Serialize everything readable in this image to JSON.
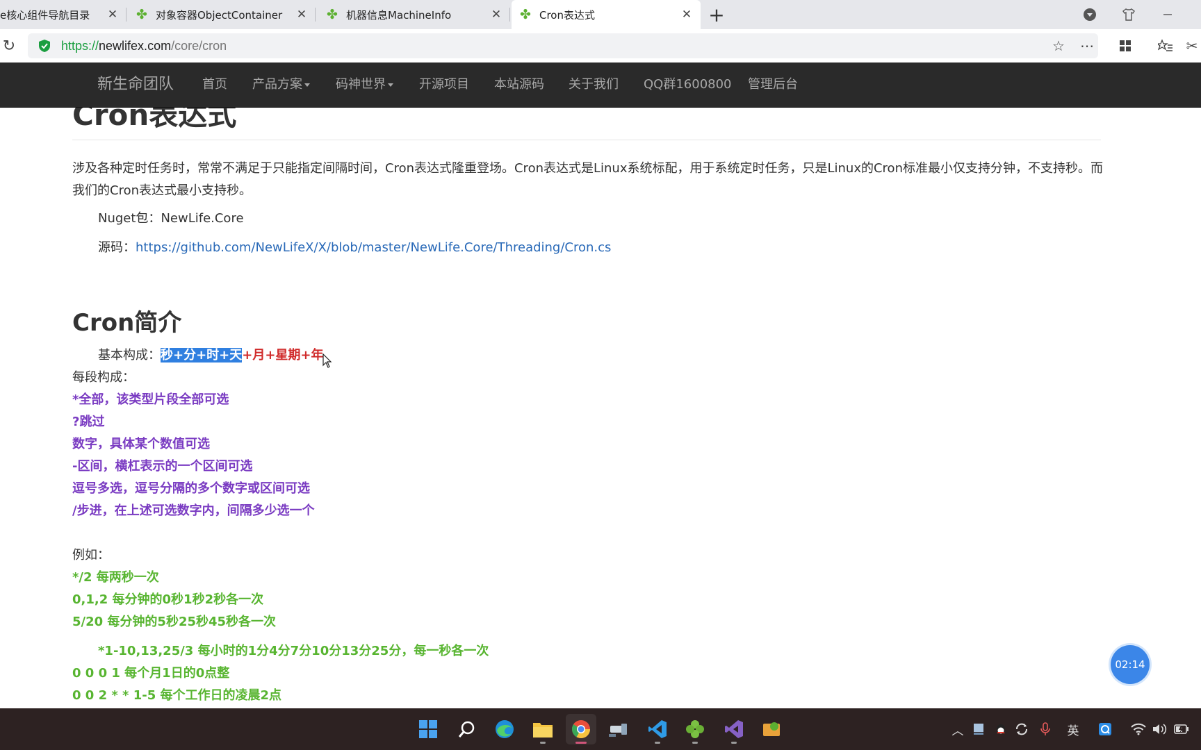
{
  "browser": {
    "tabs": [
      {
        "label": "e核心组件导航目录",
        "icon": "clover-icon"
      },
      {
        "label": "对象容器ObjectContainer",
        "icon": "clover-icon"
      },
      {
        "label": "机器信息MachineInfo",
        "icon": "clover-icon"
      },
      {
        "label": "Cron表达式",
        "icon": "clover-icon",
        "active": true
      }
    ],
    "new_tab": "+",
    "close_glyph": "✕",
    "url": {
      "scheme": "https://",
      "host": "newlifex.com",
      "path": "/core/cron"
    }
  },
  "site": {
    "brand": "新生命团队",
    "nav": [
      {
        "label": "首页"
      },
      {
        "label": "产品方案",
        "dropdown": true
      },
      {
        "label": "码神世界",
        "dropdown": true
      },
      {
        "label": "开源项目"
      },
      {
        "label": "本站源码"
      },
      {
        "label": "关于我们"
      },
      {
        "label": "QQ群1600800"
      },
      {
        "label": "管理后台"
      }
    ]
  },
  "article": {
    "title": "Cron表达式",
    "intro": "涉及各种定时任务时，常常不满足于只能指定间隔时间，Cron表达式隆重登场。Cron表达式是Linux系统标配，用于系统定时任务，只是Linux的Cron标准最小仅支持分钟，不支持秒。而我们的Cron表达式最小支持秒。",
    "nuget_label": "Nuget包：",
    "nuget_value": "NewLife.Core",
    "source_label": "源码：",
    "source_link": "https://github.com/NewLifeX/X/blob/master/NewLife.Core/Threading/Cron.cs",
    "section_title": "Cron简介",
    "basic_label": "基本构成：",
    "basic_selected": "秒+分+时+天",
    "basic_rest": "+月+星期+年",
    "segment_label": "每段构成：",
    "segments": [
      "*全部，该类型片段全部可选",
      "?跳过",
      "数字，具体某个数值可选",
      "-区间，横杠表示的一个区间可选",
      "逗号多选，逗号分隔的多个数字或区间可选",
      "/步进，在上述可选数字内，间隔多少选一个"
    ],
    "example_label": "例如：",
    "examples": [
      "*/2 每两秒一次",
      "0,1,2 每分钟的0秒1秒2秒各一次",
      "5/20 每分钟的5秒25秒45秒各一次",
      "*1-10,13,25/3 每小时的1分4分7分10分13分25分，每一秒各一次",
      "0 0 0 1 每个月1日的0点整",
      "0 0 2 * * 1-5 每个工作日的凌晨2点"
    ]
  },
  "timer": "02:14",
  "taskbar": {
    "apps": [
      "windows-start-icon",
      "search-icon",
      "edge-icon",
      "file-explorer-icon",
      "chrome-icon",
      "tool-icon",
      "vscode-icon",
      "clover-icon",
      "visual-studio-icon",
      "app-icon"
    ],
    "ime": "英"
  },
  "colors": {
    "selection": "#2f7fe0",
    "red": "#d02a2a",
    "purple": "#7a3bc2",
    "green": "#58b531",
    "link": "#2a6ab8",
    "navbar": "#2a2a2a"
  }
}
